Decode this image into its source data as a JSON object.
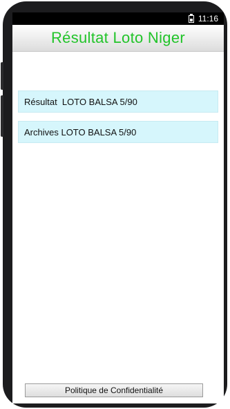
{
  "status_bar": {
    "time": "11:16",
    "battery_icon": "battery-icon"
  },
  "header": {
    "title": "Résultat Loto Niger",
    "title_color": "#22c42a"
  },
  "menu": {
    "items": [
      {
        "label": "Résultat  LOTO BALSA 5/90"
      },
      {
        "label": "Archives LOTO BALSA 5/90"
      }
    ],
    "item_background": "#d6f6fc"
  },
  "footer": {
    "privacy_label": "Politique de Confidentialité"
  }
}
